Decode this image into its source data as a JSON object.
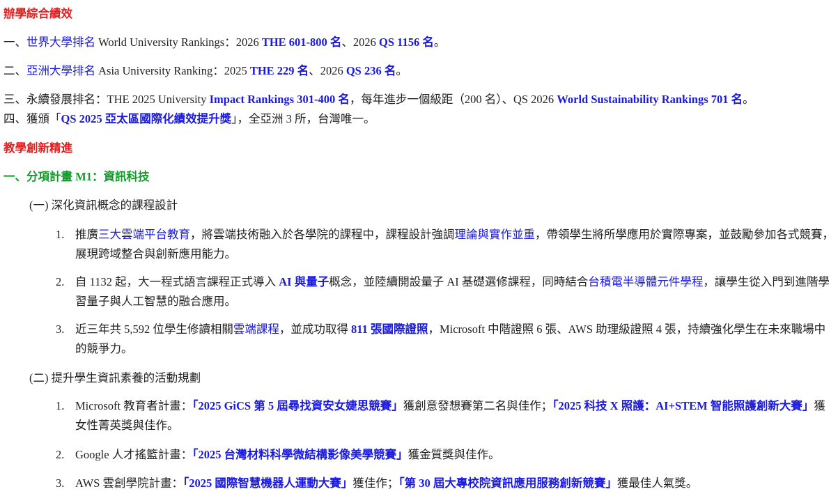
{
  "sections": {
    "performance_title": "辦學綜合績效",
    "p1": {
      "prefix": "一、",
      "link": "世界大學排名",
      "text1": " World University Rankings：2026 ",
      "the": "THE 601-800 名",
      "sep": "、2026 ",
      "qs": "QS 1156 名",
      "end": "。"
    },
    "p2": {
      "prefix": "二、",
      "link": "亞洲大學排名",
      "text1": " Asia University Ranking：2025 ",
      "the": "THE 229 名",
      "sep": "、2026 ",
      "qs": "QS 236 名",
      "end": "。"
    },
    "p3": {
      "text1": "三、永續發展排名：THE 2025 University ",
      "impact": "Impact Rankings 301-400 名",
      "text2": "，每年進步一個級距（200 名）、QS 2026 ",
      "wsr": "World Sustainability Rankings 701 名",
      "end": "。"
    },
    "p4": {
      "text1": "四、獲頒「",
      "award": "QS 2025  亞太區國際化績效提升獎",
      "text2": "」，全亞洲 3 所，台灣唯一。"
    },
    "innovation_title": "教學創新精進",
    "m1_title": "一、分項計畫 M1：資訊科技",
    "sub1": {
      "label": "(一) 深化資訊概念的課程設計",
      "items": [
        {
          "num": "1.",
          "t1": "推廣",
          "b1": "三大雲端平台教育",
          "t2": "，將雲端技術融入於各學院的課程中，課程設計強調",
          "b2": "理論與實作並重",
          "t3": "，帶領學生將所學應用於實際專案，並鼓勵參加各式競賽，展現跨域整合與創新應用能力。"
        },
        {
          "num": "2.",
          "t1": "自 1132 起，大一程式語言課程正式導入 ",
          "b1": "AI 與量子",
          "t2": "概念，並陸續開設量子 AI 基礎選修課程，同時結合",
          "b2": "台積電半導體元件學程",
          "t3": "，讓學生從入門到進階學習量子與人工智慧的融合應用。"
        },
        {
          "num": "3.",
          "t1": "近三年共 5,592 位學生修讀相關",
          "b1": "雲端課程",
          "t2": "，並成功取得 ",
          "b2": "811 張國際證照",
          "t3": "，Microsoft 中階證照 6 張、AWS 助理級證照 4 張，持續強化學生在未來職場中的競爭力。"
        }
      ]
    },
    "sub2": {
      "label": "(二) 提升學生資訊素養的活動規劃",
      "items": [
        {
          "num": "1.",
          "t1": "Microsoft 教育者計畫：",
          "b1": "「2025 GiCS 第 5 屆尋找資安女婕思競賽」",
          "t2": "獲創意發想賽第二名與佳作；",
          "b2": "「2025 科技 X 照護：AI+STEM 智能照護創新大賽」",
          "t3": "獲女性菁英獎與佳作。"
        },
        {
          "num": "2.",
          "t1": "Google 人才搖籃計畫：",
          "b1": "「2025 台灣材料科學微結構影像美學競賽」",
          "t2": "獲金質獎與佳作。",
          "b2": "",
          "t3": ""
        },
        {
          "num": "3.",
          "t1": "AWS 雲創學院計畫：",
          "b1": "「2025 國際智慧機器人運動大賽」",
          "t2": "獲佳作；",
          "b2": "「第 30 屆大專校院資訊應用服務創新競賽」",
          "t3": "獲最佳人氣獎。"
        }
      ]
    }
  },
  "colors": {
    "heading_red": "#e02020",
    "heading_green": "#149a2a",
    "link_blue": "#1a1ae0",
    "text": "#222222"
  }
}
